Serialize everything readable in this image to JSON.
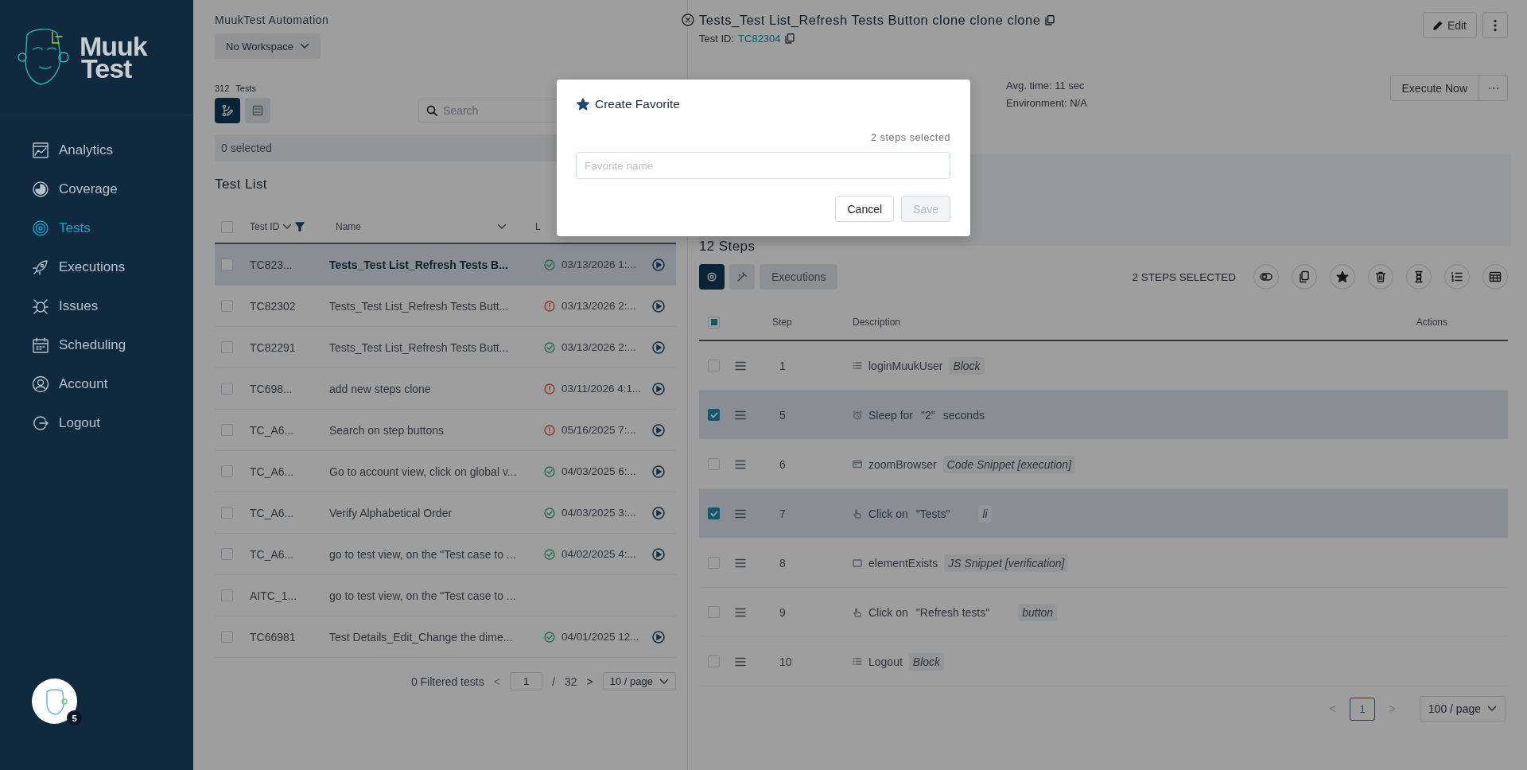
{
  "sidebar": {
    "logo": {
      "line_1": "Muuk",
      "line_2": "Test"
    },
    "items": [
      {
        "label": "Analytics",
        "kind": "analytics",
        "selected": false
      },
      {
        "label": "Coverage",
        "kind": "coverage",
        "selected": false
      },
      {
        "label": "Tests",
        "kind": "tests",
        "selected": true
      },
      {
        "label": "Executions",
        "kind": "executions",
        "selected": false
      },
      {
        "label": "Issues",
        "kind": "issues",
        "selected": false
      },
      {
        "label": "Scheduling",
        "kind": "scheduling",
        "selected": false
      },
      {
        "label": "Account",
        "kind": "account",
        "selected": false
      },
      {
        "label": "Logout",
        "kind": "logout",
        "selected": false
      }
    ],
    "avatar": {
      "badge": "5"
    }
  },
  "workspace": {
    "title": "MuukTest Automation",
    "selector": "No Workspace"
  },
  "test_list": {
    "count": "312",
    "count_label": "Tests",
    "view_toggles": [
      {
        "kind": "flow",
        "selected": true
      },
      {
        "kind": "grid",
        "selected": false
      }
    ],
    "search": {
      "placeholder": "Search"
    },
    "selected_count": "0 selected",
    "title": "Test List",
    "header_checkbox": {
      "checked": false
    },
    "columns": [
      "Test ID",
      "Name",
      "L"
    ],
    "rows": [
      {
        "id": "TC823...",
        "name": "Tests_Test List_Refresh Tests B...",
        "kind": "passed",
        "date": "03/13/2026 1:...",
        "selected": true,
        "checked": false
      },
      {
        "id": "TC82302",
        "name": "Tests_Test List_Refresh Tests Butt...",
        "kind": "failed",
        "date": "03/13/2026 2:...",
        "selected": false,
        "checked": false
      },
      {
        "id": "TC82291",
        "name": "Tests_Test List_Refresh Tests Butt...",
        "kind": "passed",
        "date": "03/13/2026 2:...",
        "selected": false,
        "checked": false
      },
      {
        "id": "TC698...",
        "name": "add new steps clone",
        "kind": "failed",
        "date": "03/11/2026 4:1...",
        "selected": false,
        "checked": false
      },
      {
        "id": "TC_A6...",
        "name": "Search on step buttons",
        "kind": "failed",
        "date": "05/16/2025 7:...",
        "selected": false,
        "checked": false
      },
      {
        "id": "TC_A6...",
        "name": "Go to account view, click on global v...",
        "kind": "passed",
        "date": "04/03/2025 6:...",
        "selected": false,
        "checked": false
      },
      {
        "id": "TC_A6...",
        "name": "Verify Alphabetical Order",
        "kind": "passed",
        "date": "04/03/2025 3:...",
        "selected": false,
        "checked": false
      },
      {
        "id": "TC_A6...",
        "name": "go to test view, on the \"Test case to ...",
        "kind": "passed",
        "date": "04/02/2025 4:...",
        "selected": false,
        "checked": false
      },
      {
        "id": "AITC_1...",
        "name": "go to test view, on the \"Test case to ...",
        "selected": false,
        "checked": false
      },
      {
        "id": "TC66981",
        "name": "Test Details_Edit_Change the dime...",
        "kind": "passed",
        "date": "04/01/2025 12...",
        "selected": false,
        "checked": false
      }
    ],
    "pagination": {
      "summary": "0 Filtered tests",
      "prev": "<",
      "page": "1",
      "separator": "/",
      "total": "32",
      "next": ">",
      "per_page": "10 / page"
    }
  },
  "detail": {
    "title": "Tests_Test List_Refresh Tests Button clone clone clone",
    "test_id_label": "Test ID:",
    "test_id": "TC82304",
    "edit": "Edit",
    "avg_time": "Avg. time: 11 sec",
    "environment": "Environment: N/A",
    "execute": "Execute Now",
    "steps_title": "12 Steps",
    "tabs": [
      {
        "kind": "steps",
        "selected": true
      },
      {
        "kind": "edit",
        "selected": false
      },
      {
        "kind": "text",
        "label": "Executions",
        "selected": false
      }
    ],
    "selection_label": "2 STEPS SELECTED",
    "tools": [
      {
        "kind": "toggle"
      },
      {
        "kind": "copy"
      },
      {
        "kind": "favorite"
      },
      {
        "kind": "delete"
      },
      {
        "kind": "wait"
      },
      {
        "kind": "list"
      },
      {
        "kind": "table"
      }
    ],
    "columns": [
      "Step",
      "Description",
      "Actions"
    ],
    "header_checkbox": {
      "partial": true
    },
    "steps": [
      {
        "number": "1",
        "kind": "block",
        "parts": [
          "loginMuukUser"
        ],
        "tag": "Block",
        "checked": false
      },
      {
        "number": "5",
        "kind": "sleep",
        "parts": [
          "Sleep for",
          "\"2\"",
          "seconds"
        ],
        "checked": true
      },
      {
        "number": "6",
        "kind": "code",
        "parts": [
          "zoomBrowser"
        ],
        "tag": "Code Snippet [execution]",
        "checked": false
      },
      {
        "number": "7",
        "kind": "click",
        "parts": [
          "Click on",
          "\"Tests\""
        ],
        "tag": "li",
        "checked": true
      },
      {
        "number": "8",
        "kind": "exists",
        "parts": [
          "elementExists"
        ],
        "tag": "JS Snippet [verification]",
        "checked": false
      },
      {
        "number": "9",
        "kind": "click",
        "parts": [
          "Click on",
          "\"Refresh tests\""
        ],
        "tag": "button",
        "checked": false
      },
      {
        "number": "10",
        "kind": "block",
        "parts": [
          "Logout"
        ],
        "tag": "Block",
        "checked": false
      }
    ],
    "pagination": {
      "prev": "<",
      "page": "1",
      "next": ">",
      "per_page": "100 / page"
    }
  },
  "modal": {
    "title": "Create Favorite",
    "count": "2 steps selected",
    "input": {
      "placeholder": "Favorite name"
    },
    "buttons": [
      {
        "label": "Cancel",
        "kind": "secondary",
        "disabled": false
      },
      {
        "label": "Save",
        "kind": "primary",
        "disabled": true
      }
    ]
  }
}
